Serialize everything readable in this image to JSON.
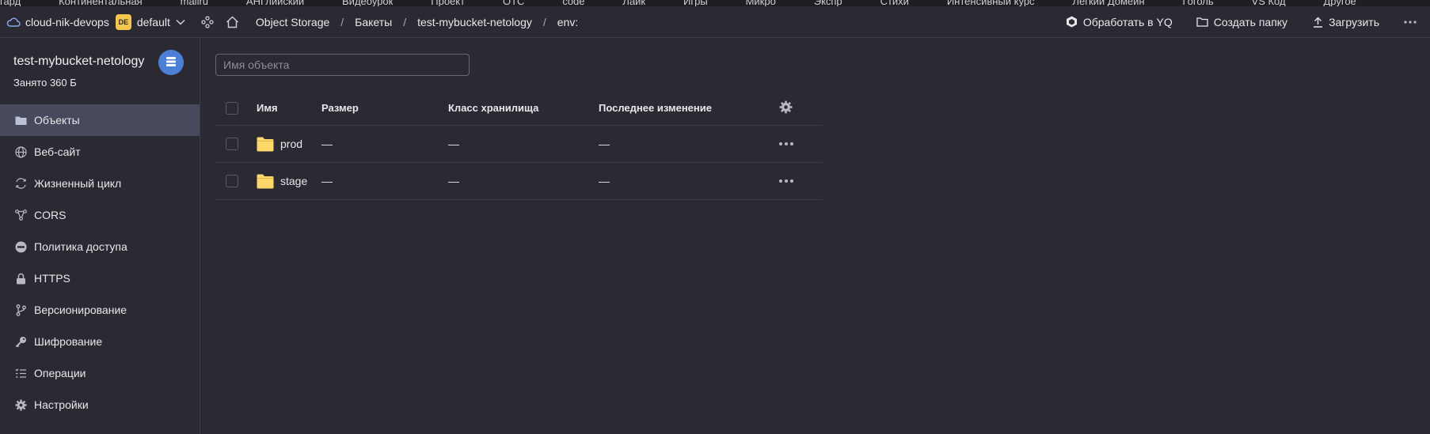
{
  "bookmarks": [
    "гард",
    "Континентальная",
    "mailru",
    "АНГлийский",
    "Видеоурок",
    "Проект",
    "OTC",
    "code",
    "Лайк",
    "Игры",
    "Микро",
    "Экспр",
    "Стихи",
    "Интенсивный курс",
    "Лёгкий Домейн",
    "Гоголь",
    "VS Код",
    "Другое"
  ],
  "header": {
    "cloud_name": "cloud-nik-devops",
    "folder_badge": "DE",
    "folder_name": "default",
    "breadcrumb": [
      "Object Storage",
      "Бакеты",
      "test-mybucket-netology",
      "env:"
    ],
    "separator": "/",
    "actions": [
      {
        "label": "Обработать в YQ",
        "icon": "yq-hexagon-icon"
      },
      {
        "label": "Создать папку",
        "icon": "folder-plus-icon"
      },
      {
        "label": "Загрузить",
        "icon": "upload-icon"
      }
    ]
  },
  "sidebar": {
    "bucket_name": "test-mybucket-netology",
    "bucket_usage": "Занято 360 Б",
    "items": [
      {
        "label": "Объекты",
        "icon": "folder-icon",
        "active": true
      },
      {
        "label": "Веб-сайт",
        "icon": "globe-icon"
      },
      {
        "label": "Жизненный цикл",
        "icon": "cycle-icon"
      },
      {
        "label": "CORS",
        "icon": "cors-icon"
      },
      {
        "label": "Политика доступа",
        "icon": "no-entry-icon"
      },
      {
        "label": "HTTPS",
        "icon": "lock-icon"
      },
      {
        "label": "Версионирование",
        "icon": "branch-icon"
      },
      {
        "label": "Шифрование",
        "icon": "key-icon"
      },
      {
        "label": "Операции",
        "icon": "list-icon"
      },
      {
        "label": "Настройки",
        "icon": "gear-icon"
      }
    ]
  },
  "main": {
    "search_placeholder": "Имя объекта",
    "columns": {
      "name": "Имя",
      "size": "Размер",
      "class": "Класс хранилища",
      "modified": "Последнее изменение"
    },
    "rows": [
      {
        "name": "prod",
        "size": "—",
        "class": "—",
        "modified": "—"
      },
      {
        "name": "stage",
        "size": "—",
        "class": "—",
        "modified": "—"
      }
    ]
  },
  "colors": {
    "background": "#2b2a33",
    "active_nav": "#464a5c",
    "accent_avatar": "#4c7fd6",
    "folder_badge": "#f5c64b",
    "folder_icon": "#fcd86a"
  }
}
